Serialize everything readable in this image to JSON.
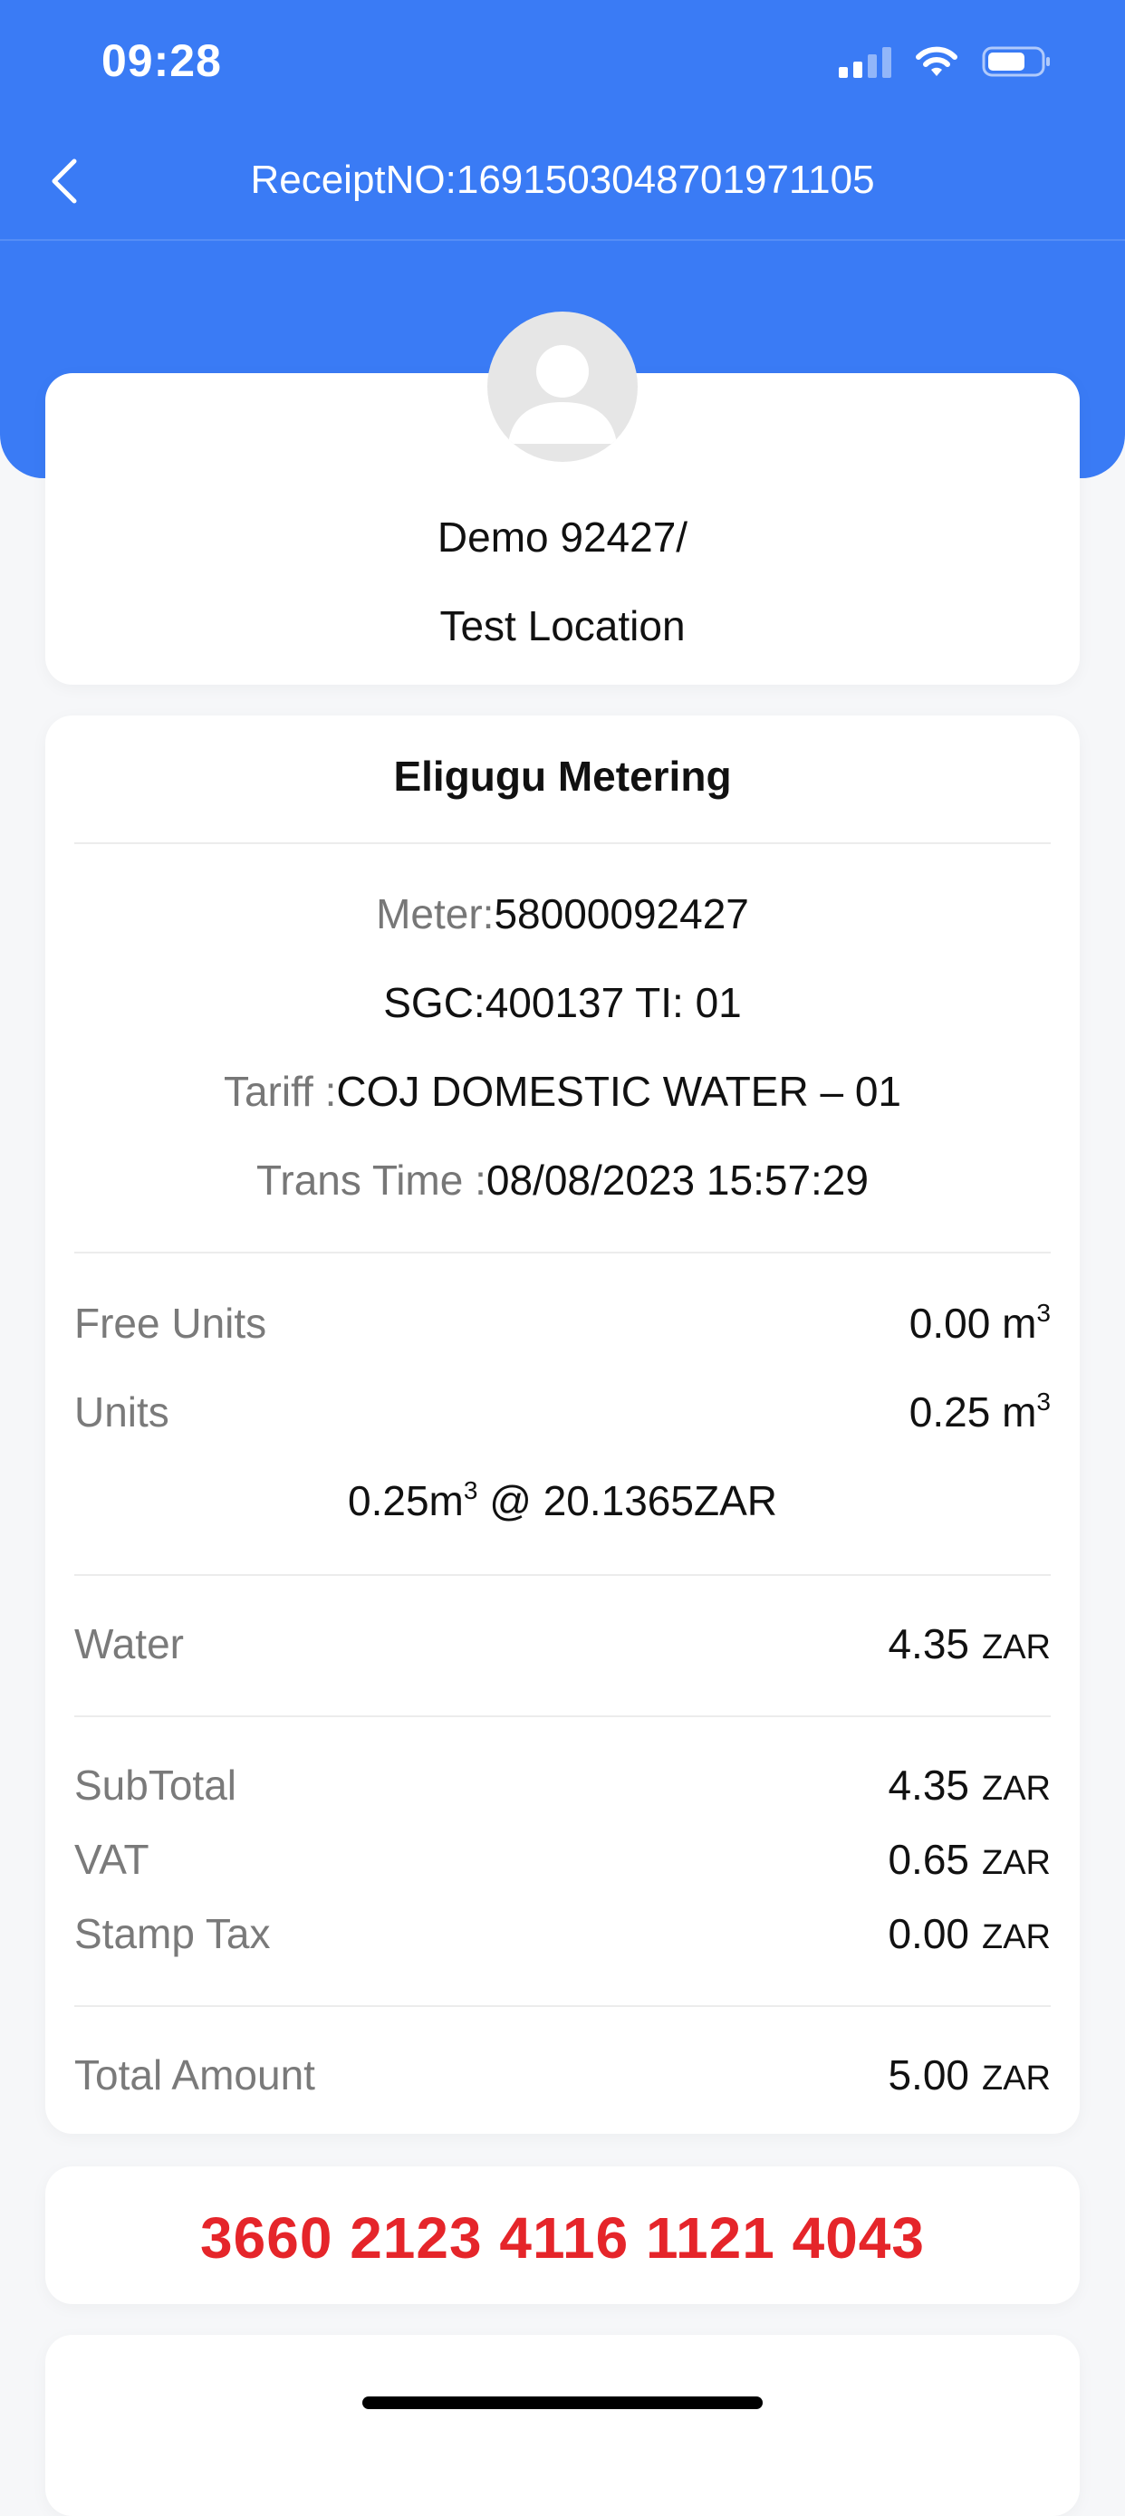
{
  "status_bar": {
    "time": "09:28"
  },
  "header": {
    "title": "ReceiptNO:1691503048701971105"
  },
  "profile": {
    "name": "Demo 92427/",
    "location": "Test Location"
  },
  "receipt": {
    "company": "Eligugu Metering",
    "meter_label": "Meter:",
    "meter_value": "58000092427",
    "sgc": "SGC:400137 TI: 01",
    "tariff_label": "Tariff :",
    "tariff_value": "COJ DOMESTIC WATER – 01",
    "trans_time_label": "Trans Time :",
    "trans_time_value": "08/08/2023 15:57:29",
    "free_units_label": "Free Units",
    "free_units_value": "0.00 m",
    "free_units_unit_sup": "3",
    "units_label": "Units",
    "units_value": "0.25 m",
    "units_unit_sup": "3",
    "rate_a": "0.25m",
    "rate_sup": "3",
    "rate_b": " @ 20.1365ZAR",
    "water_label": "Water",
    "water_value": "4.35",
    "subtotal_label": "SubTotal",
    "subtotal_value": "4.35",
    "vat_label": "VAT",
    "vat_value": "0.65",
    "stamp_tax_label": "Stamp Tax",
    "stamp_tax_value": "0.00",
    "total_label": "Total Amount",
    "total_value": "5.00",
    "currency": "ZAR"
  },
  "token": "3660 2123 4116 1121 4043",
  "colors": {
    "primary": "#3a7bf5",
    "token": "#e5252a",
    "background": "#f6f7f9"
  },
  "icons": [
    "back-arrow-icon",
    "signal-icon",
    "wifi-icon",
    "battery-icon",
    "avatar-icon"
  ]
}
